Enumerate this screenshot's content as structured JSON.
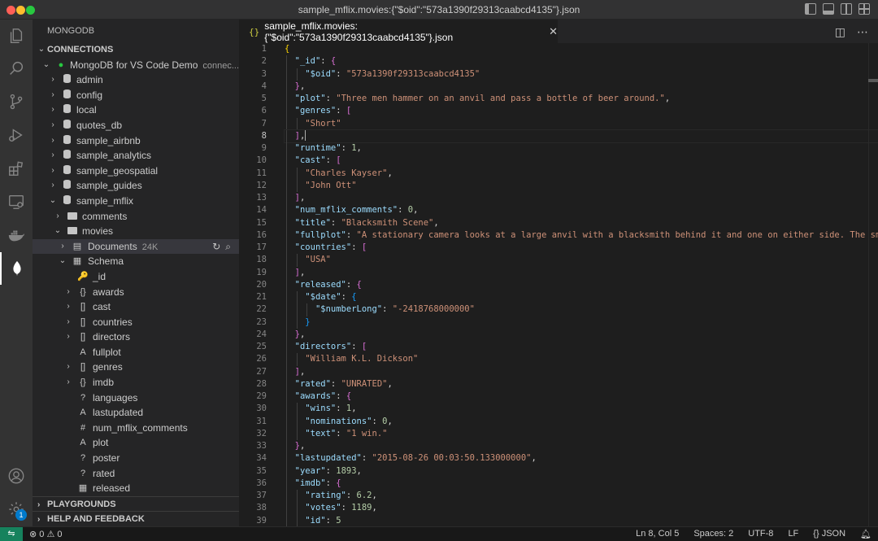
{
  "window": {
    "title": "sample_mflix.movies:{\"$oid\":\"573a1390f29313caabcd4135\"}.json"
  },
  "activity_bar": {
    "items": [
      {
        "name": "explorer-icon",
        "active": false
      },
      {
        "name": "search-icon",
        "active": false
      },
      {
        "name": "source-control-icon",
        "active": false
      },
      {
        "name": "run-debug-icon",
        "active": false
      },
      {
        "name": "extensions-icon",
        "active": false
      },
      {
        "name": "remote-explorer-icon",
        "active": false
      },
      {
        "name": "docker-icon",
        "active": false
      },
      {
        "name": "mongodb-leaf-icon",
        "active": true
      }
    ],
    "settings_badge": "1"
  },
  "sidebar": {
    "title": "MONGODB",
    "connections_header": "CONNECTIONS",
    "connection": {
      "label": "MongoDB for VS Code Demo",
      "desc": "connec..."
    },
    "databases": [
      "admin",
      "config",
      "local",
      "quotes_db",
      "sample_airbnb",
      "sample_analytics",
      "sample_geospatial",
      "sample_guides",
      "sample_mflix"
    ],
    "collections": [
      "comments",
      "movies"
    ],
    "documents": {
      "label": "Documents",
      "count": "24K"
    },
    "schema_label": "Schema",
    "fields": [
      {
        "icon": "key",
        "glyph": "🔑",
        "label": "_id",
        "expandable": false
      },
      {
        "icon": "object",
        "glyph": "{}",
        "label": "awards",
        "expandable": true
      },
      {
        "icon": "array",
        "glyph": "[]",
        "label": "cast",
        "expandable": true
      },
      {
        "icon": "array",
        "glyph": "[]",
        "label": "countries",
        "expandable": true
      },
      {
        "icon": "array",
        "glyph": "[]",
        "label": "directors",
        "expandable": true
      },
      {
        "icon": "string",
        "glyph": "A",
        "label": "fullplot",
        "expandable": false
      },
      {
        "icon": "array",
        "glyph": "[]",
        "label": "genres",
        "expandable": true
      },
      {
        "icon": "object",
        "glyph": "{}",
        "label": "imdb",
        "expandable": true
      },
      {
        "icon": "unknown",
        "glyph": "?",
        "label": "languages",
        "expandable": false
      },
      {
        "icon": "string",
        "glyph": "A",
        "label": "lastupdated",
        "expandable": false
      },
      {
        "icon": "number",
        "glyph": "#",
        "label": "num_mflix_comments",
        "expandable": false
      },
      {
        "icon": "string",
        "glyph": "A",
        "label": "plot",
        "expandable": false
      },
      {
        "icon": "unknown",
        "glyph": "?",
        "label": "poster",
        "expandable": false
      },
      {
        "icon": "unknown",
        "glyph": "?",
        "label": "rated",
        "expandable": false
      },
      {
        "icon": "date",
        "glyph": "▦",
        "label": "released",
        "expandable": false
      }
    ],
    "playgrounds": "PLAYGROUNDS",
    "help": "HELP AND FEEDBACK"
  },
  "editor": {
    "tab_label": "sample_mflix.movies:{\"$oid\":\"573a1390f29313caabcd4135\"}.json",
    "tab_icon": "{}",
    "current_line": 8,
    "lines": [
      "{",
      "  \"_id\": {",
      "    \"$oid\": \"573a1390f29313caabcd4135\"",
      "  },",
      "  \"plot\": \"Three men hammer on an anvil and pass a bottle of beer around.\",",
      "  \"genres\": [",
      "    \"Short\"",
      "  ],",
      "  \"runtime\": 1,",
      "  \"cast\": [",
      "    \"Charles Kayser\",",
      "    \"John Ott\"",
      "  ],",
      "  \"num_mflix_comments\": 0,",
      "  \"title\": \"Blacksmith Scene\",",
      "  \"fullplot\": \"A stationary camera looks at a large anvil with a blacksmith behind it and one on either side. The smith in the middle draws a heated metal rod from the fire, places it on the anvil, and all three begin a rhythmic hammering.\",",
      "  \"countries\": [",
      "    \"USA\"",
      "  ],",
      "  \"released\": {",
      "    \"$date\": {",
      "      \"$numberLong\": \"-2418768000000\"",
      "    }",
      "  },",
      "  \"directors\": [",
      "    \"William K.L. Dickson\"",
      "  ],",
      "  \"rated\": \"UNRATED\",",
      "  \"awards\": {",
      "    \"wins\": 1,",
      "    \"nominations\": 0,",
      "    \"text\": \"1 win.\"",
      "  },",
      "  \"lastupdated\": \"2015-08-26 00:03:50.133000000\",",
      "  \"year\": 1893,",
      "  \"imdb\": {",
      "    \"rating\": 6.2,",
      "    \"votes\": 1189,",
      "    \"id\": 5"
    ]
  },
  "status_bar": {
    "errors": "0",
    "warnings": "0",
    "position": "Ln 8, Col 5",
    "spaces": "Spaces: 2",
    "encoding": "UTF-8",
    "eol": "LF",
    "language": "JSON"
  }
}
